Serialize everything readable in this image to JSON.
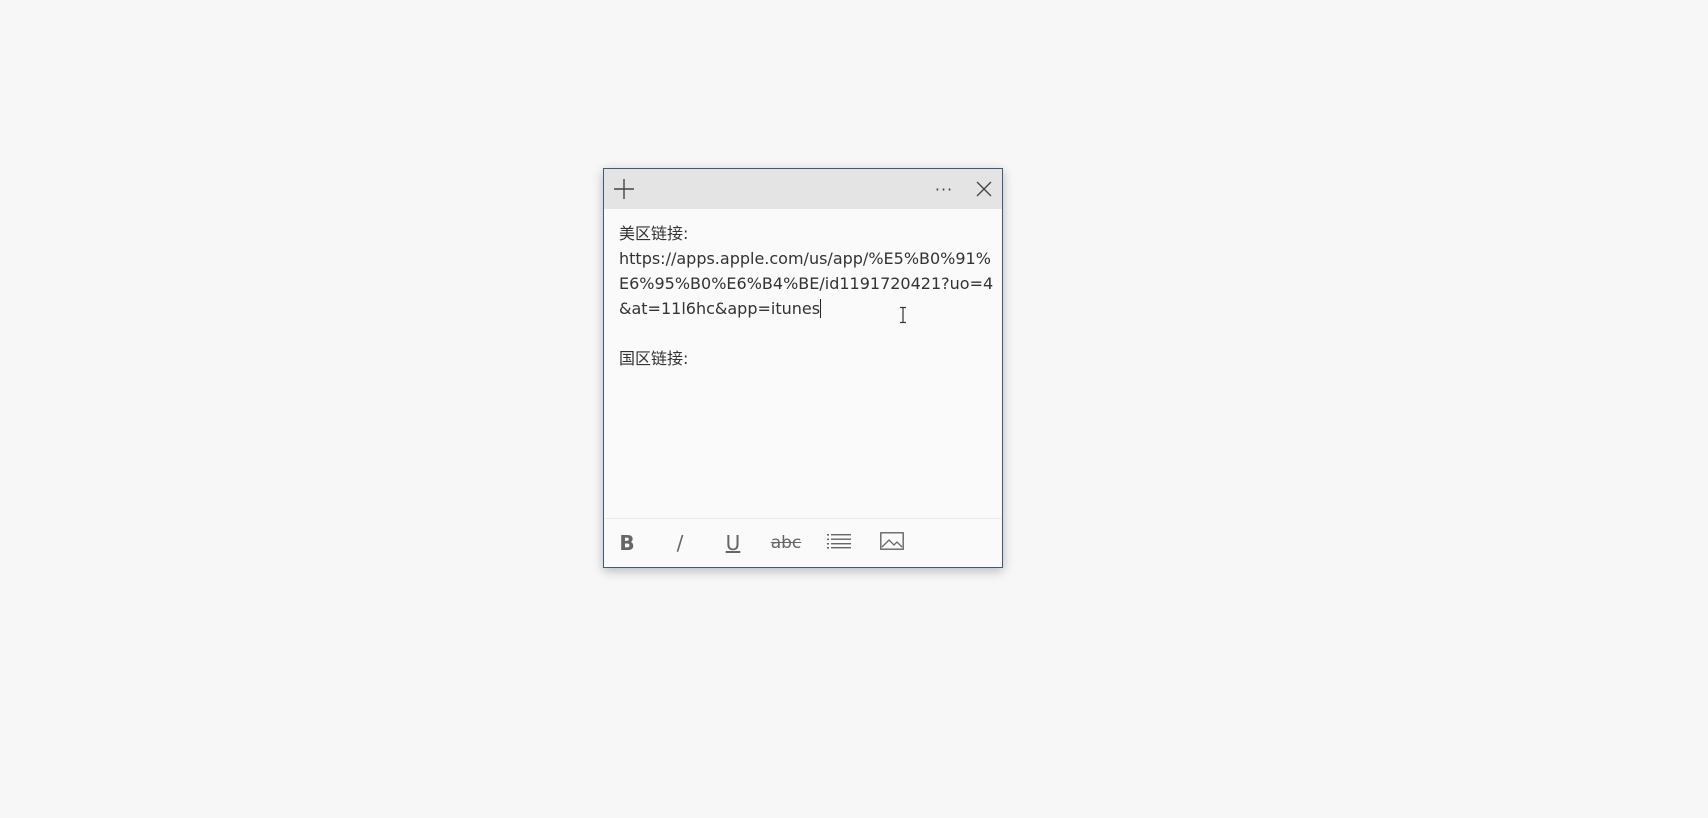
{
  "window": {
    "type": "sticky-note",
    "border_color": "#3f5a80",
    "titlebar_color": "#e4e4e4",
    "background_color": "#fafafa"
  },
  "titlebar": {
    "add_icon": "plus-icon",
    "menu_icon": "more-icon",
    "more_label": "···",
    "close_icon": "close-icon"
  },
  "note": {
    "lines": [
      "美区链接:",
      "https://apps.apple.com/us/app/%E5%B0%91%",
      "E6%95%B0%E6%B4%BE/id1191720421?uo=4",
      "&at=11l6hc&app=itunes",
      "",
      "国区链接:"
    ]
  },
  "toolbar": {
    "bold_label": "B",
    "italic_label": "/",
    "underline_label": "U",
    "strike_label": "abc",
    "list_icon": "bullet-list-icon",
    "image_icon": "image-icon"
  }
}
